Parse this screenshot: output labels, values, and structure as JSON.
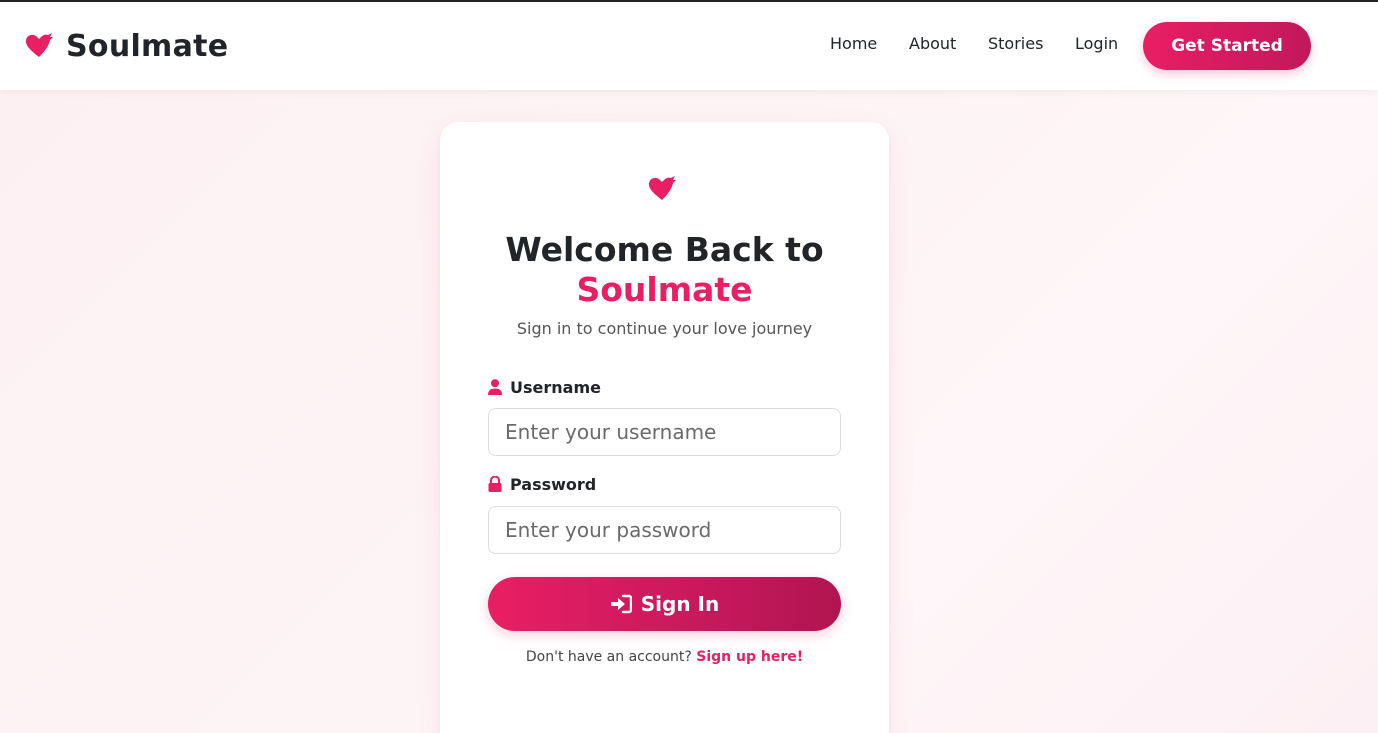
{
  "brand": {
    "name": "Soulmate",
    "icon": "heart-icon",
    "accent_color": "#e91e63"
  },
  "nav": {
    "links": [
      {
        "label": "Home"
      },
      {
        "label": "About"
      },
      {
        "label": "Stories"
      },
      {
        "label": "Login"
      }
    ],
    "cta_label": "Get Started"
  },
  "login": {
    "icon": "heart-icon",
    "title_line1": "Welcome Back to",
    "title_line2": "Soulmate",
    "subtitle": "Sign in to continue your love journey",
    "username": {
      "icon": "user-icon",
      "label": "Username",
      "placeholder": "Enter your username",
      "value": ""
    },
    "password": {
      "icon": "lock-icon",
      "label": "Password",
      "placeholder": "Enter your password",
      "value": ""
    },
    "submit": {
      "icon": "sign-in-icon",
      "label": "Sign In"
    },
    "signup_prompt": "Don't have an account?",
    "signup_link": "Sign up here!"
  }
}
